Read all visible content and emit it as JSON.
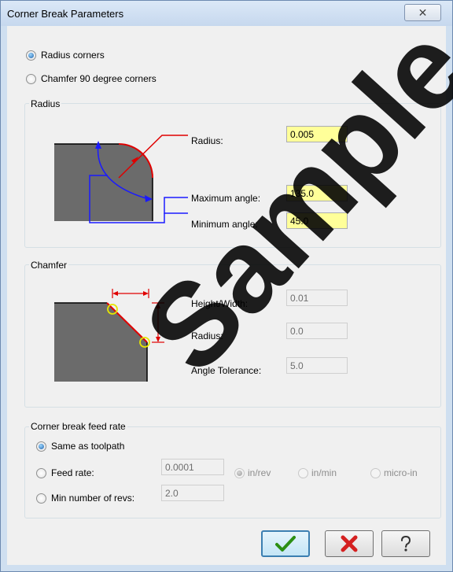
{
  "window": {
    "title": "Corner Break Parameters",
    "close_glyph": "✕"
  },
  "mode": {
    "radius_corners": "Radius corners",
    "chamfer_corners": "Chamfer 90 degree corners",
    "selected": "radius_corners"
  },
  "radius_group": {
    "legend": "Radius",
    "radius_label": "Radius:",
    "radius_value": "0.005",
    "max_angle_label": "Maximum angle:",
    "max_angle_value": "135.0",
    "min_angle_label": "Minimum angle:",
    "min_angle_value": "45.0"
  },
  "chamfer_group": {
    "legend": "Chamfer",
    "height_width_label": "Height/Width:",
    "height_width_value": "0.01",
    "radius_label": "Radius:",
    "radius_value": "0.0",
    "angle_tol_label": "Angle Tolerance:",
    "angle_tol_value": "5.0"
  },
  "feed_group": {
    "legend": "Corner break feed rate",
    "same_as_toolpath": "Same as toolpath",
    "feed_rate_label": "Feed rate:",
    "feed_rate_value": "0.0001",
    "unit_in_rev": "in/rev",
    "unit_in_min": "in/min",
    "unit_micro_in": "micro-in",
    "min_revs_label": "Min number of revs:",
    "min_revs_value": "2.0",
    "selected": "same_as_toolpath"
  },
  "buttons": {
    "ok_icon": "checkmark-icon",
    "cancel_icon": "red-x-icon",
    "help_icon": "question-icon"
  },
  "watermark": {
    "text": "Sample"
  },
  "colors": {
    "required_field": "#ffff99",
    "diagram_red": "#e00000",
    "diagram_blue": "#1a1aff",
    "part_gray": "#6b6b6b"
  }
}
